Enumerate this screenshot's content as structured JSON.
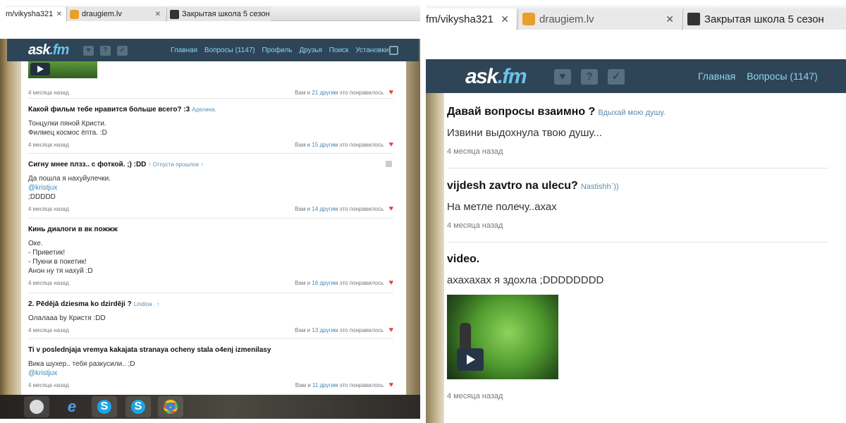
{
  "left": {
    "tabs": [
      {
        "title": "m/vikysha321"
      },
      {
        "title": "draugiem.lv"
      },
      {
        "title": "Закрытая школа 5 сезон"
      }
    ],
    "logo": {
      "name": "ask",
      "tld": ".fm"
    },
    "nav": [
      "Главная",
      "Вопросы (1147)",
      "Профиль",
      "Друзья",
      "Поиск",
      "Установки"
    ],
    "feed": [
      {
        "meta": "4 месяца назад",
        "likes_prefix": "Вам и",
        "likes_link": "21 другим",
        "likes_suffix": "это понравилось"
      },
      {
        "question": "Какой фильм тебе нравится больше всего? :3",
        "asker": "Аделина.",
        "answer_lines": [
          "Тонцулки пяной Кристи.",
          "Филмец космос ёпта. :D"
        ],
        "meta": "4 месяца назад",
        "likes_prefix": "Вам и",
        "likes_link": "15 другим",
        "likes_suffix": "это понравилось"
      },
      {
        "question": "Сигну мнее плзз.. с фоткой. ;) :DD",
        "asker": "↑ Отпусти прошлое ↑",
        "answer_lines": [
          "Да пошла я нахуйулечки.",
          "@kristjux",
          ";DDDDD"
        ],
        "meta": "4 месяца назад",
        "likes_prefix": "Вам и",
        "likes_link": "14 другим",
        "likes_suffix": "это понравилось"
      },
      {
        "question": "Кинь диалоги в вк пожжж",
        "asker": "",
        "answer_lines": [
          "Оке.",
          "- Приветик!",
          "- Пукни в покетик!",
          "Анон ну тя нахуй :D"
        ],
        "meta": "4 месяца назад",
        "likes_prefix": "Вам и",
        "likes_link": "16 другим",
        "likes_suffix": "это понравилось"
      },
      {
        "question": "2. Pēdējā dziesma ko dzirdēji ?",
        "asker": "Lindiņa . ↑",
        "answer_lines": [
          "Олалааа by Кристя :DD"
        ],
        "meta": "4 месяца назад",
        "likes_prefix": "Вам и",
        "likes_link": "13 другим",
        "likes_suffix": "это понравилось"
      },
      {
        "question": "Ti v poslednjaja vremya kakajata stranaya ocheny stala o4enj izmenilasy",
        "asker": "",
        "answer_lines": [
          "Вика шухер.. тебя разкусили.. ;D",
          "@kristjux"
        ],
        "meta": "4 месяца назад",
        "likes_prefix": "Вам и",
        "likes_link": "11 другим",
        "likes_suffix": "это понравилось"
      }
    ],
    "taskbar_icons": [
      "hp-icon",
      "internet-explorer-icon",
      "skype-icon",
      "skype-icon",
      "chrome-icon"
    ]
  },
  "right": {
    "tabs": [
      {
        "title": "fm/vikysha321"
      },
      {
        "title": "draugiem.lv"
      },
      {
        "title": "Закрытая школа 5 сезон"
      }
    ],
    "logo": {
      "name": "ask",
      "tld": ".fm"
    },
    "nav": [
      "Главная",
      "Вопросы (1147)"
    ],
    "feed": [
      {
        "question": "Давай вопросы взаимно ?",
        "asker": "Вдыхай мою душу.",
        "answer": "Извини выдохнула твою душу...",
        "meta": "4 месяца назад"
      },
      {
        "question": "vijdesh zavtro na ulecu?",
        "asker": "Nastishh`))",
        "answer": "На метле полечу..ахах",
        "meta": "4 месяца назад"
      },
      {
        "question": "video.",
        "asker": "",
        "answer": "ахахахах я здохла ;DDDDDDDD",
        "meta": "4 месяца назад"
      }
    ]
  },
  "colors": {
    "header": "#2d4557",
    "accent": "#8fd3f5",
    "heart": "#e04848",
    "link": "#3d86b8"
  }
}
